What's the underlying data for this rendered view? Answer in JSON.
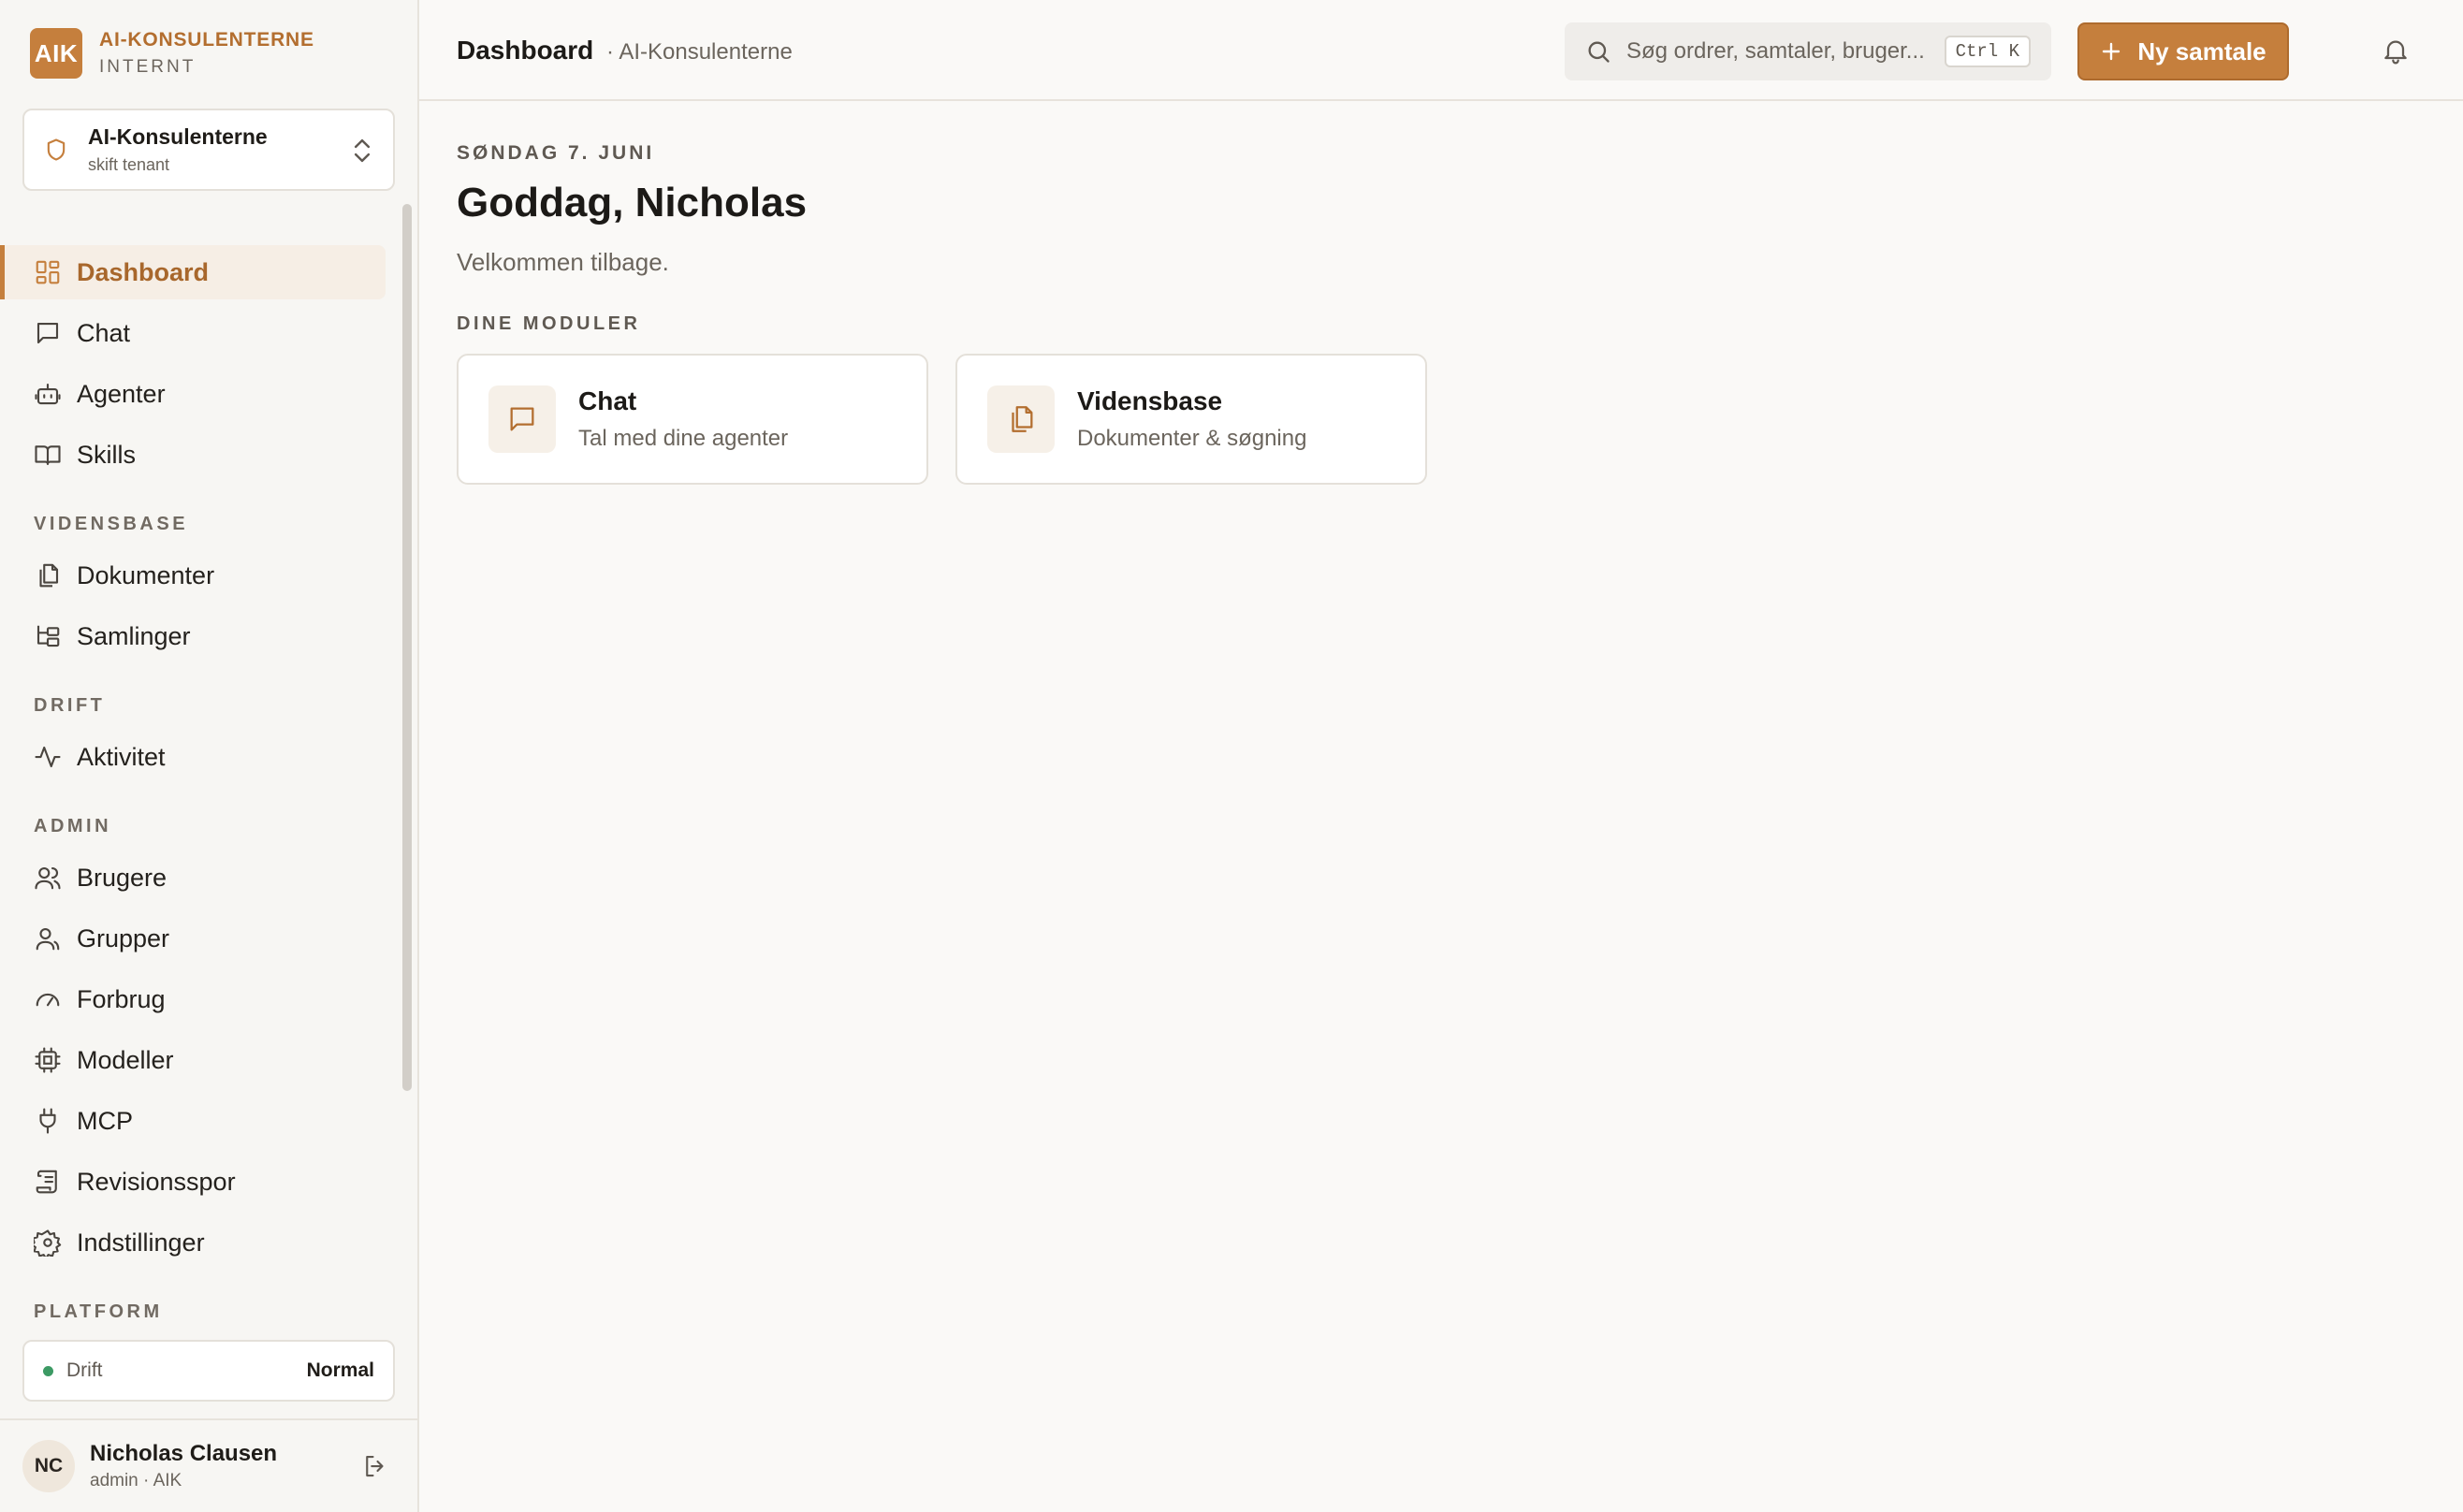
{
  "brand": {
    "logo": "AIK",
    "name": "AI-KONSULENTERNE",
    "sub": "INTERNT"
  },
  "tenant": {
    "name": "AI-Konsulenterne",
    "sub": "skift tenant",
    "icon": "shield-icon"
  },
  "nav": {
    "main": [
      {
        "label": "Dashboard",
        "icon": "grid-icon",
        "active": true
      },
      {
        "label": "Chat",
        "icon": "message-icon"
      },
      {
        "label": "Agenter",
        "icon": "bot-icon"
      },
      {
        "label": "Skills",
        "icon": "book-icon"
      }
    ],
    "sections": [
      {
        "label": "VIDENSBASE",
        "items": [
          {
            "label": "Dokumenter",
            "icon": "files-icon"
          },
          {
            "label": "Samlinger",
            "icon": "folder-tree-icon"
          }
        ]
      },
      {
        "label": "DRIFT",
        "items": [
          {
            "label": "Aktivitet",
            "icon": "activity-icon"
          }
        ]
      },
      {
        "label": "ADMIN",
        "items": [
          {
            "label": "Brugere",
            "icon": "users-icon"
          },
          {
            "label": "Grupper",
            "icon": "group-icon"
          },
          {
            "label": "Forbrug",
            "icon": "gauge-icon"
          },
          {
            "label": "Modeller",
            "icon": "cpu-icon"
          },
          {
            "label": "MCP",
            "icon": "plug-icon"
          },
          {
            "label": "Revisionsspor",
            "icon": "scroll-icon"
          },
          {
            "label": "Indstillinger",
            "icon": "gear-icon"
          }
        ]
      },
      {
        "label": "PLATFORM",
        "items": []
      }
    ]
  },
  "status": {
    "label": "Drift",
    "value": "Normal",
    "color": "#3c9a64"
  },
  "user": {
    "initials": "NC",
    "name": "Nicholas Clausen",
    "role": "admin · AIK"
  },
  "header": {
    "title": "Dashboard",
    "subtitle": "· AI-Konsulenterne",
    "search_placeholder": "Søg ordrer, samtaler, bruger...",
    "search_shortcut": "Ctrl K",
    "new_button": "Ny samtale"
  },
  "main": {
    "date": "SØNDAG 7. JUNI",
    "greeting": "Goddag, Nicholas",
    "welcome": "Velkommen tilbage.",
    "modules_label": "DINE MODULER",
    "modules": [
      {
        "title": "Chat",
        "desc": "Tal med dine agenter",
        "icon": "message-icon"
      },
      {
        "title": "Vidensbase",
        "desc": "Dokumenter & søgning",
        "icon": "files-icon"
      }
    ]
  },
  "colors": {
    "accent": "#c57f3d",
    "accent_text": "#a8672c",
    "background": "#faf9f7",
    "sidebar": "#f7f6f3"
  }
}
